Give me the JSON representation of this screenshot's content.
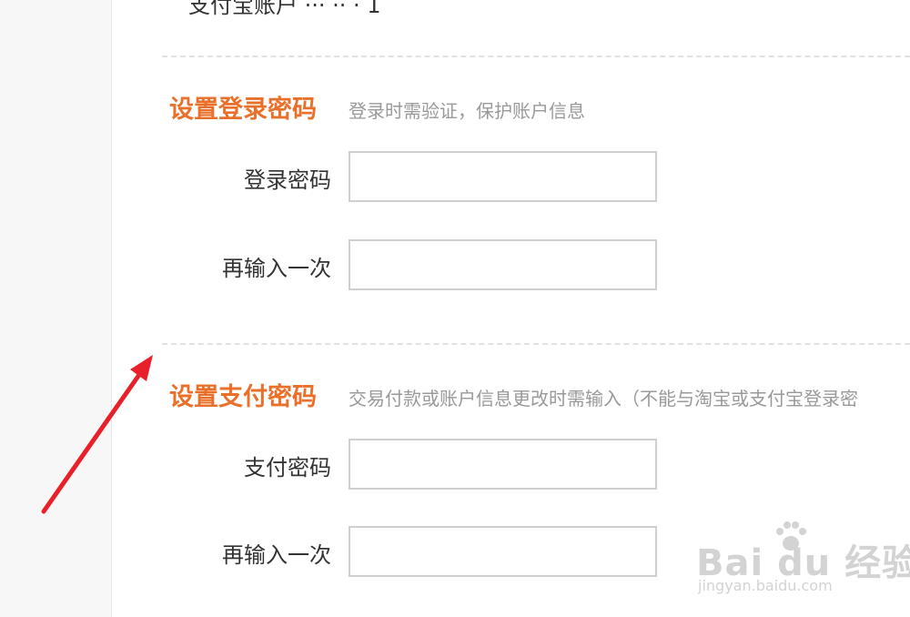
{
  "top_cut_text": "支付宝账户  ···  ··  ·  1",
  "sections": [
    {
      "title": "设置登录密码",
      "hint": "登录时需验证，保护账户信息",
      "fields": [
        {
          "label": "登录密码",
          "value": "",
          "placeholder": ""
        },
        {
          "label": "再输入一次",
          "value": "",
          "placeholder": ""
        }
      ]
    },
    {
      "title": "设置支付密码",
      "hint": "交易付款或账户信息更改时需输入（不能与淘宝或支付宝登录密",
      "fields": [
        {
          "label": "支付密码",
          "value": "",
          "placeholder": ""
        },
        {
          "label": "再输入一次",
          "value": "",
          "placeholder": ""
        }
      ]
    }
  ],
  "annotation": {
    "icon": "red-arrow-icon",
    "color": "#e8202a"
  },
  "watermark": {
    "logo": "Bai du 经验",
    "url": "jingyan.baidu.com"
  },
  "colors": {
    "accent": "#e8702a",
    "hint": "#999999",
    "label": "#333333",
    "input_border": "#cfcfcf"
  }
}
